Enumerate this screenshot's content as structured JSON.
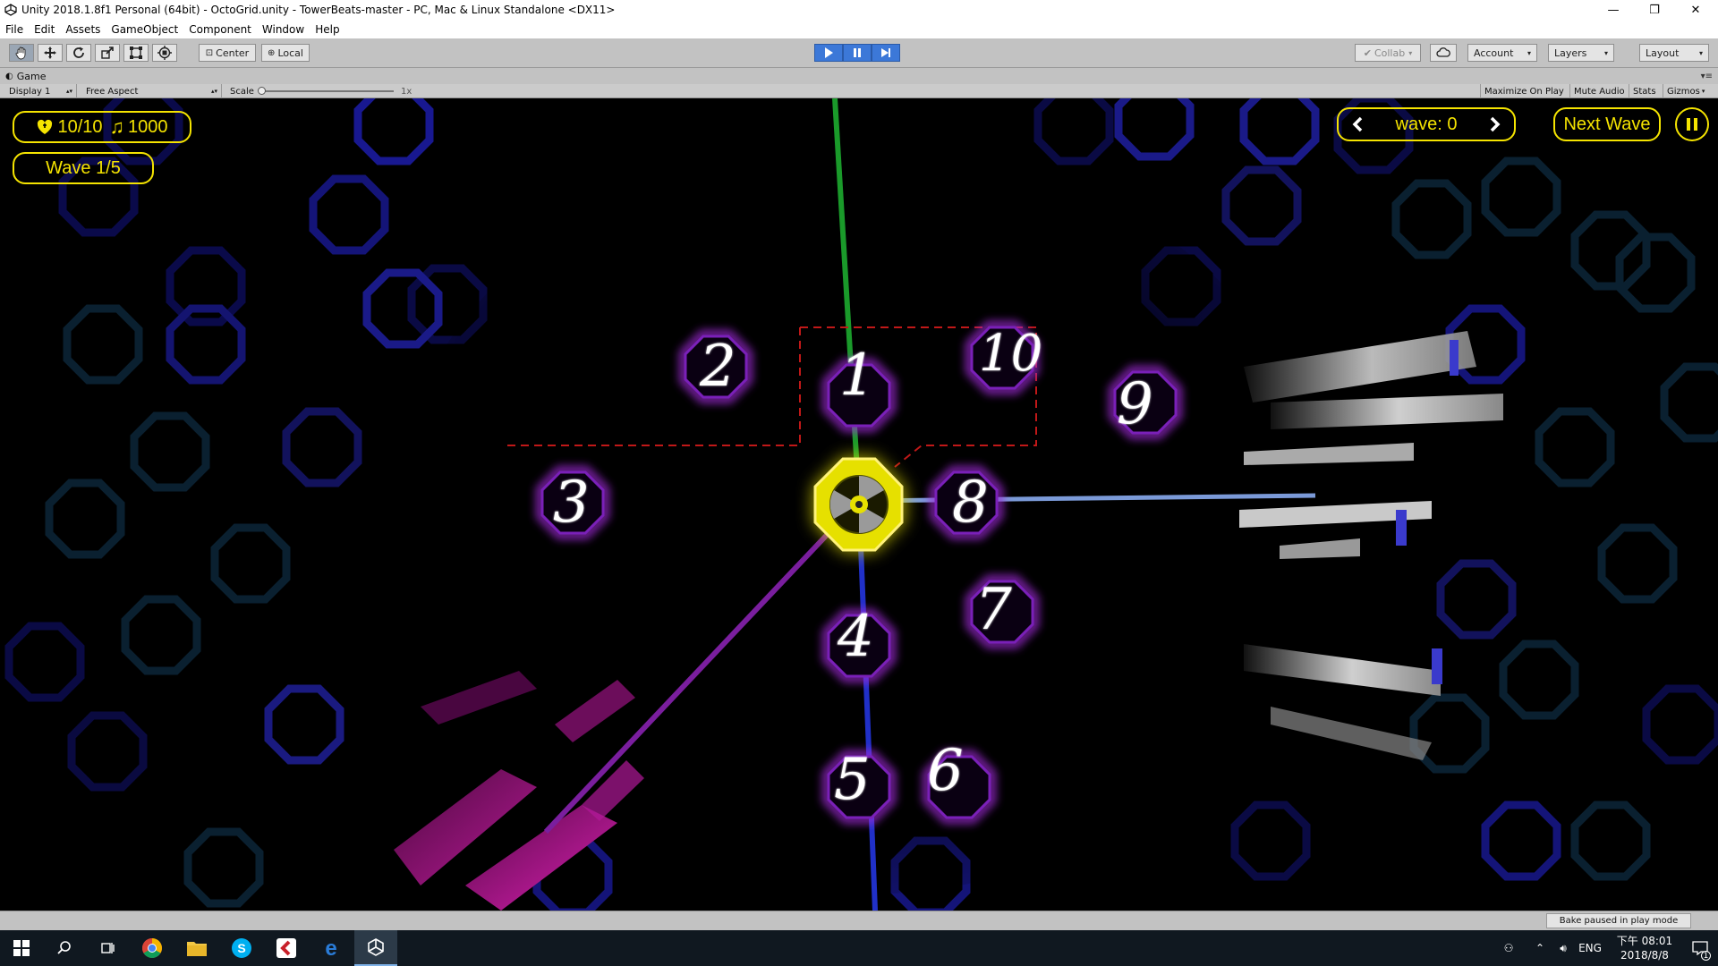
{
  "window": {
    "title": "Unity 2018.1.8f1 Personal (64bit) - OctoGrid.unity - TowerBeats-master - PC, Mac & Linux Standalone <DX11>",
    "controls": {
      "minimize": "—",
      "maximize": "❐",
      "close": "✕"
    }
  },
  "menu": [
    "File",
    "Edit",
    "Assets",
    "GameObject",
    "Component",
    "Window",
    "Help"
  ],
  "toolbar": {
    "transform_tools": [
      "hand-icon",
      "move-icon",
      "rotate-icon",
      "scale-icon",
      "rect-icon",
      "transform-icon"
    ],
    "pivot": "Center",
    "space": "Local",
    "play_controls": [
      "play-icon",
      "pause-icon",
      "step-icon"
    ],
    "collab": "Collab",
    "account": "Account",
    "layers": "Layers",
    "layout": "Layout",
    "accent": "#3c78d8"
  },
  "game_tab": {
    "title": "Game",
    "display": "Display 1",
    "aspect": "Free Aspect",
    "scale_label": "Scale",
    "scale_value": "1x",
    "options": [
      "Maximize On Play",
      "Mute Audio",
      "Stats",
      "Gizmos"
    ]
  },
  "hud": {
    "lives": "10/10",
    "money": "1000",
    "wave": "Wave 1/5",
    "wave_selector": "wave: 0",
    "next_wave": "Next Wave",
    "accent": "#f5e400"
  },
  "board": {
    "labels": [
      "1",
      "2",
      "3",
      "4",
      "5",
      "6",
      "7",
      "8",
      "9",
      "10"
    ]
  },
  "status": {
    "bake": "Bake paused in play mode"
  },
  "taskbar": {
    "apps": [
      "windows-icon",
      "search-icon",
      "task-view-icon",
      "chrome-icon",
      "file-explorer-icon",
      "skype-icon",
      "app-icon",
      "edge-icon",
      "unity-icon"
    ],
    "lang": "ENG",
    "time": "下午 08:01",
    "date": "2018/8/8",
    "notifications": "1"
  }
}
